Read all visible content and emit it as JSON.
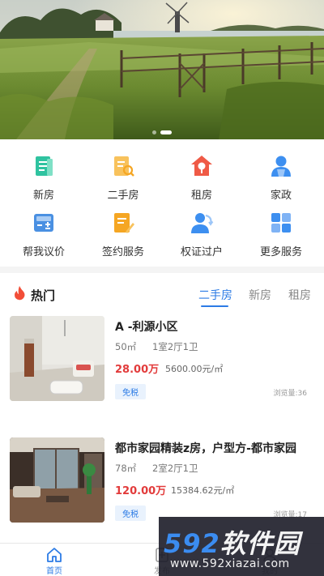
{
  "banner": {
    "slide_count": 2,
    "active_slide": 1
  },
  "services": [
    {
      "label": "新房",
      "icon": "new-house-icon",
      "color": "#2fc3a0"
    },
    {
      "label": "二手房",
      "icon": "second-hand-house-icon",
      "color": "#f5a623"
    },
    {
      "label": "租房",
      "icon": "rent-house-icon",
      "color": "#ef5a46"
    },
    {
      "label": "家政",
      "icon": "housekeeping-icon",
      "color": "#3d8ff0"
    },
    {
      "label": "帮我议价",
      "icon": "calculator-icon",
      "color": "#4a90e2"
    },
    {
      "label": "签约服务",
      "icon": "contract-icon",
      "color": "#f5a623"
    },
    {
      "label": "权证过户",
      "icon": "transfer-icon",
      "color": "#3d8ff0"
    },
    {
      "label": "更多服务",
      "icon": "grid-icon",
      "color": "#3d8ff0"
    }
  ],
  "hot": {
    "title": "热门",
    "tabs": [
      "二手房",
      "新房",
      "租房"
    ],
    "active_tab": 0,
    "listings": [
      {
        "title": "A -利源小区",
        "area": "50㎡",
        "layout": "1室2厅1卫",
        "price": "28.00万",
        "unit_price": "5600.00元/㎡",
        "tag": "免税",
        "views": "浏览量:36"
      },
      {
        "title": "都市家园精装z房，户型方-都市家园",
        "area": "78㎡",
        "layout": "2室2厅1卫",
        "price": "120.00万",
        "unit_price": "15384.62元/㎡",
        "tag": "免税",
        "views": "浏览量:17"
      }
    ]
  },
  "tabbar": {
    "items": [
      {
        "label": "首页",
        "icon": "home-icon"
      },
      {
        "label": "发布",
        "icon": "publish-icon"
      },
      {
        "label": "我的",
        "icon": "profile-icon"
      }
    ],
    "active": 0
  },
  "watermark": {
    "number": "592",
    "text": "软件园",
    "url": "www.592xiazai.com"
  },
  "colors": {
    "accent": "#2c7be5",
    "price": "#e23b3b"
  }
}
